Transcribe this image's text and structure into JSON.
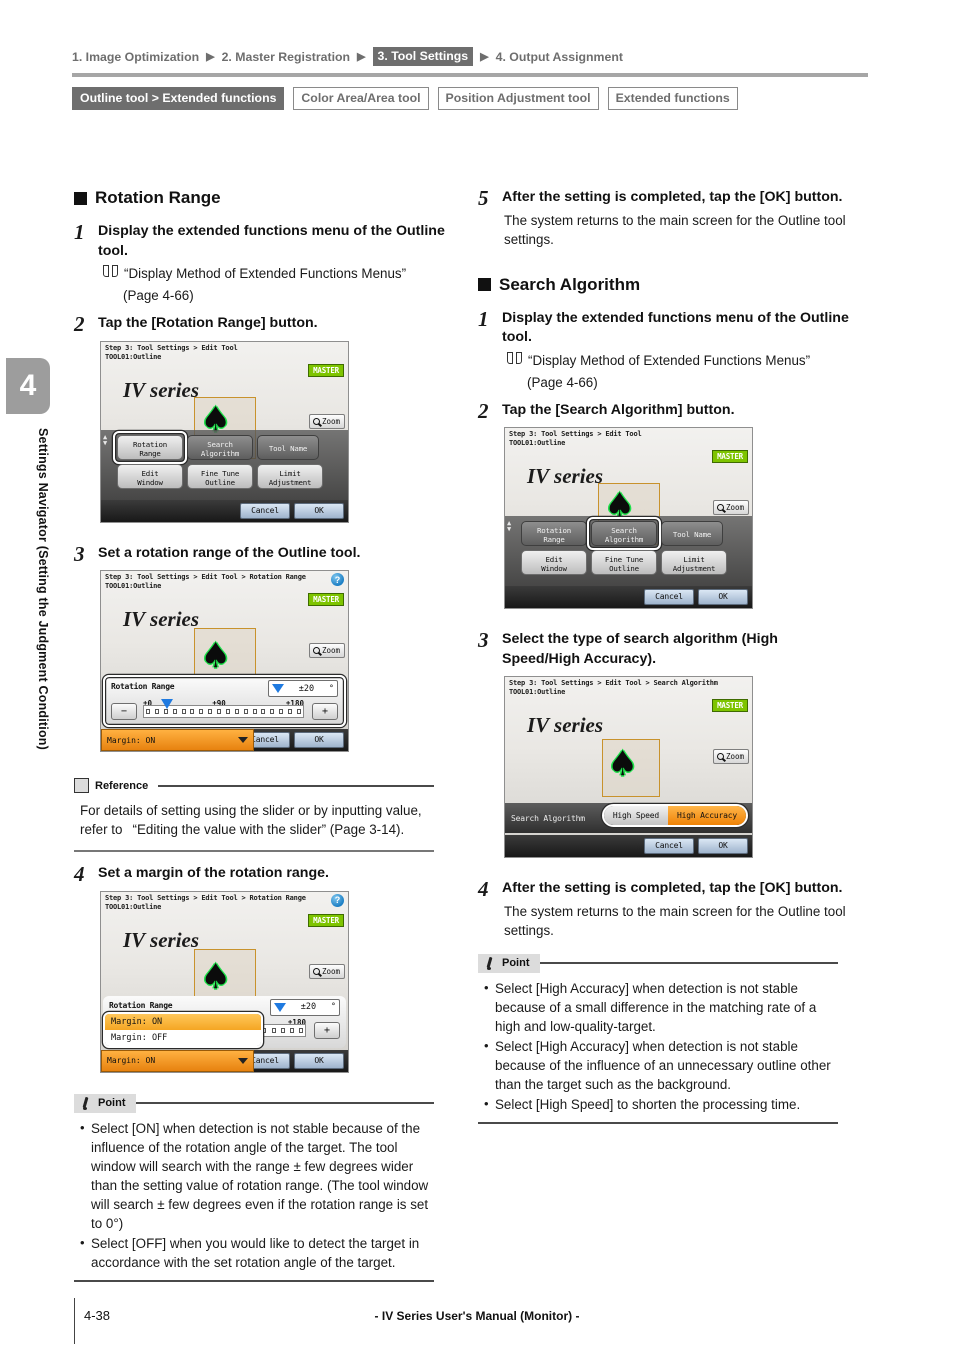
{
  "topnav": {
    "items": [
      {
        "label": "1. Image Optimization",
        "active": false
      },
      {
        "label": "2. Master Registration",
        "active": false
      },
      {
        "label": "3. Tool Settings",
        "active": true
      },
      {
        "label": "4. Output Assignment",
        "active": false
      }
    ],
    "arrow": "▶"
  },
  "tooltabs": [
    {
      "label": "Outline tool > Extended functions",
      "current": true
    },
    {
      "label": "Color Area/Area tool",
      "current": false
    },
    {
      "label": "Position Adjustment tool",
      "current": false
    },
    {
      "label": "Extended functions",
      "current": false
    }
  ],
  "sidetab": {
    "number": "4",
    "text": "Settings Navigator (Setting the Judgment Condition)"
  },
  "left": {
    "section_title": "Rotation Range",
    "step1": {
      "num": "1",
      "title": "Display the extended functions menu of the Outline tool.",
      "xref": "“Display Method of Extended Functions Menus”",
      "xref_page": "(Page 4-66)"
    },
    "step2": {
      "num": "2",
      "title": "Tap the [Rotation Range] button."
    },
    "step3": {
      "num": "3",
      "title": "Set a rotation range of the Outline tool."
    },
    "step4": {
      "num": "4",
      "title": "Set a margin of the rotation range."
    },
    "reference": {
      "tag": "Reference",
      "text": "For details of setting using the slider or by inputting value, refer to   “Editing the value with the slider” (Page 3-14)."
    },
    "point": {
      "tag": "Point",
      "items": [
        "Select [ON] when detection is not stable because of the influence of the rotation angle of the target. The tool window will search with the range ± few degrees wider than the setting value of rotation range. (The tool window will search ± few degrees even if the rotation range is set to 0°)",
        "Select [OFF] when you would like to detect the target in accordance with the set rotation angle of the target."
      ]
    }
  },
  "right": {
    "step5": {
      "num": "5",
      "title": "After the setting is completed, tap the [OK] button.",
      "sub": "The system returns to the main screen for the Outline tool settings."
    },
    "section_title": "Search Algorithm",
    "step1": {
      "num": "1",
      "title": "Display the extended functions menu of the Outline tool.",
      "xref": "“Display Method of Extended Functions Menus”",
      "xref_page": "(Page 4-66)"
    },
    "step2": {
      "num": "2",
      "title": "Tap the [Search Algorithm] button."
    },
    "step3": {
      "num": "3",
      "title": "Select the type of search algorithm (High Speed/High Accuracy)."
    },
    "step4": {
      "num": "4",
      "title": "After the setting is completed, tap the [OK] button.",
      "sub": "The system returns to the main screen for the Outline tool settings."
    },
    "point": {
      "tag": "Point",
      "items": [
        "Select [High Accuracy] when detection is not stable because of a small difference in the matching rate of a high and low-quality-target.",
        "Select [High Accuracy] when detection is not stable because of the influence of an unnecessary outline other than the target such as the background.",
        "Select [High Speed] to shorten the processing time."
      ]
    }
  },
  "device": {
    "crumb_edit": "Step 3: Tool Settings > Edit Tool",
    "crumb_rotation": "Step 3: Tool Settings > Edit Tool > Rotation Range",
    "crumb_search": "Step 3: Tool Settings > Edit Tool > Search Algorithm",
    "tool_id": "TOOL01:Outline",
    "logo": "IV series",
    "master_badge": "MASTER",
    "help_glyph": "?",
    "zoom_label": "Zoom",
    "menu": {
      "row1": [
        "Rotation Range",
        "Search Algorithm",
        "Tool Name"
      ],
      "row2": [
        "Edit Window",
        "Fine Tune Outline",
        "Limit Adjustment"
      ],
      "rotation_l1": "Rotation",
      "rotation_l2": "Range",
      "search_l1": "Search",
      "search_l2": "Algorithm",
      "toolname_l1": "Tool Name",
      "edit_l1": "Edit",
      "edit_l2": "Window",
      "fine_l1": "Fine Tune",
      "fine_l2": "Outline",
      "limit_l1": "Limit",
      "limit_l2": "Adjustment"
    },
    "cancel": "Cancel",
    "ok": "OK",
    "rotation": {
      "label": "Rotation Range",
      "value": "±20",
      "unit": "°",
      "minus": "−",
      "plus": "+",
      "tick_min": "±0",
      "tick_mid": "±90",
      "tick_max": "±180",
      "margin_selected": "Margin: ON",
      "margin_options": [
        "Margin: ON",
        "Margin: OFF"
      ]
    },
    "search": {
      "label": "Search Algorithm",
      "option_off": "High Speed",
      "option_on": "High Accuracy"
    }
  },
  "footer": {
    "page": "4-38",
    "title": "- IV Series User's Manual (Monitor) -"
  }
}
